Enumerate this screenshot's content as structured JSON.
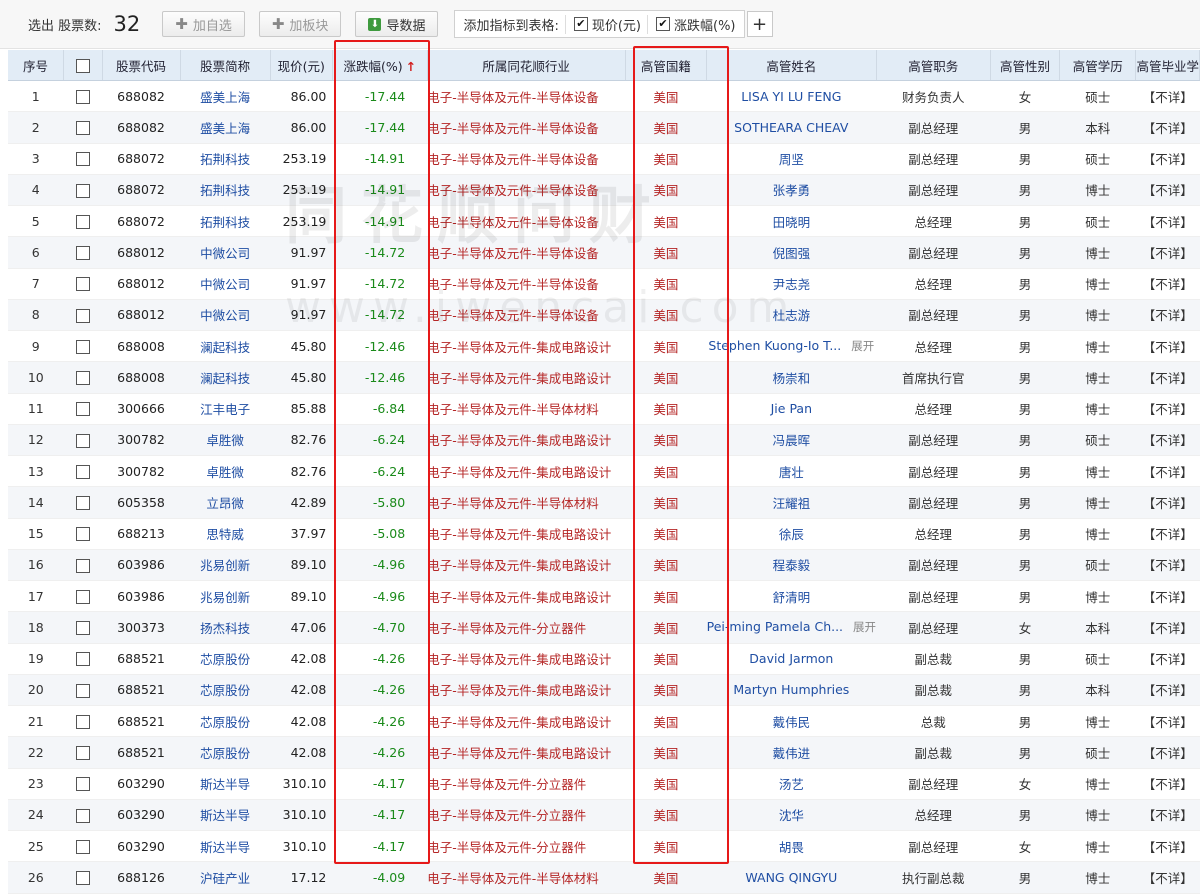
{
  "toolbar": {
    "count_label": "选出 股票数:",
    "count": "32",
    "add_watchlist": "加自选",
    "add_sector": "加板块",
    "export": "导数据",
    "add_indicator_label": "添加指标到表格:",
    "ind_price": "现价(元)",
    "ind_change": "涨跌幅(%)",
    "add_plus": "+"
  },
  "watermark": {
    "cn": "同花顺问财",
    "url": "www.iwencai.com"
  },
  "headers": {
    "seq": "序号",
    "code": "股票代码",
    "name": "股票简称",
    "price": "现价(元)",
    "change": "涨跌幅(%)",
    "industry": "所属同花顺行业",
    "nationality": "高管国籍",
    "exec_name": "高管姓名",
    "position": "高管职务",
    "gender": "高管性别",
    "education": "高管学历",
    "school": "高管毕业学"
  },
  "sort_arrow": "↑",
  "rows": [
    {
      "seq": "1",
      "code": "688082",
      "name": "盛美上海",
      "price": "86.00",
      "change": "-17.44",
      "industry": "电子-半导体及元件-半导体设备",
      "nat": "美国",
      "exec": "LISA YI LU FENG",
      "expand": "",
      "pos": "财务负责人",
      "gender": "女",
      "edu": "硕士",
      "school": "【不详】"
    },
    {
      "seq": "2",
      "code": "688082",
      "name": "盛美上海",
      "price": "86.00",
      "change": "-17.44",
      "industry": "电子-半导体及元件-半导体设备",
      "nat": "美国",
      "exec": "SOTHEARA CHEAV",
      "expand": "",
      "pos": "副总经理",
      "gender": "男",
      "edu": "本科",
      "school": "【不详】"
    },
    {
      "seq": "3",
      "code": "688072",
      "name": "拓荆科技",
      "price": "253.19",
      "change": "-14.91",
      "industry": "电子-半导体及元件-半导体设备",
      "nat": "美国",
      "exec": "周坚",
      "expand": "",
      "pos": "副总经理",
      "gender": "男",
      "edu": "硕士",
      "school": "【不详】"
    },
    {
      "seq": "4",
      "code": "688072",
      "name": "拓荆科技",
      "price": "253.19",
      "change": "-14.91",
      "industry": "电子-半导体及元件-半导体设备",
      "nat": "美国",
      "exec": "张孝勇",
      "expand": "",
      "pos": "副总经理",
      "gender": "男",
      "edu": "博士",
      "school": "【不详】"
    },
    {
      "seq": "5",
      "code": "688072",
      "name": "拓荆科技",
      "price": "253.19",
      "change": "-14.91",
      "industry": "电子-半导体及元件-半导体设备",
      "nat": "美国",
      "exec": "田晓明",
      "expand": "",
      "pos": "总经理",
      "gender": "男",
      "edu": "硕士",
      "school": "【不详】"
    },
    {
      "seq": "6",
      "code": "688012",
      "name": "中微公司",
      "price": "91.97",
      "change": "-14.72",
      "industry": "电子-半导体及元件-半导体设备",
      "nat": "美国",
      "exec": "倪图强",
      "expand": "",
      "pos": "副总经理",
      "gender": "男",
      "edu": "博士",
      "school": "【不详】"
    },
    {
      "seq": "7",
      "code": "688012",
      "name": "中微公司",
      "price": "91.97",
      "change": "-14.72",
      "industry": "电子-半导体及元件-半导体设备",
      "nat": "美国",
      "exec": "尹志尧",
      "expand": "",
      "pos": "总经理",
      "gender": "男",
      "edu": "博士",
      "school": "【不详】"
    },
    {
      "seq": "8",
      "code": "688012",
      "name": "中微公司",
      "price": "91.97",
      "change": "-14.72",
      "industry": "电子-半导体及元件-半导体设备",
      "nat": "美国",
      "exec": "杜志游",
      "expand": "",
      "pos": "副总经理",
      "gender": "男",
      "edu": "博士",
      "school": "【不详】"
    },
    {
      "seq": "9",
      "code": "688008",
      "name": "澜起科技",
      "price": "45.80",
      "change": "-12.46",
      "industry": "电子-半导体及元件-集成电路设计",
      "nat": "美国",
      "exec": "Stephen Kuong-Io T...",
      "expand": "展开",
      "pos": "总经理",
      "gender": "男",
      "edu": "博士",
      "school": "【不详】"
    },
    {
      "seq": "10",
      "code": "688008",
      "name": "澜起科技",
      "price": "45.80",
      "change": "-12.46",
      "industry": "电子-半导体及元件-集成电路设计",
      "nat": "美国",
      "exec": "杨崇和",
      "expand": "",
      "pos": "首席执行官",
      "gender": "男",
      "edu": "博士",
      "school": "【不详】"
    },
    {
      "seq": "11",
      "code": "300666",
      "name": "江丰电子",
      "price": "85.88",
      "change": "-6.84",
      "industry": "电子-半导体及元件-半导体材料",
      "nat": "美国",
      "exec": "Jie Pan",
      "expand": "",
      "pos": "总经理",
      "gender": "男",
      "edu": "博士",
      "school": "【不详】"
    },
    {
      "seq": "12",
      "code": "300782",
      "name": "卓胜微",
      "price": "82.76",
      "change": "-6.24",
      "industry": "电子-半导体及元件-集成电路设计",
      "nat": "美国",
      "exec": "冯晨晖",
      "expand": "",
      "pos": "副总经理",
      "gender": "男",
      "edu": "硕士",
      "school": "【不详】"
    },
    {
      "seq": "13",
      "code": "300782",
      "name": "卓胜微",
      "price": "82.76",
      "change": "-6.24",
      "industry": "电子-半导体及元件-集成电路设计",
      "nat": "美国",
      "exec": "唐壮",
      "expand": "",
      "pos": "副总经理",
      "gender": "男",
      "edu": "博士",
      "school": "【不详】"
    },
    {
      "seq": "14",
      "code": "605358",
      "name": "立昂微",
      "price": "42.89",
      "change": "-5.80",
      "industry": "电子-半导体及元件-半导体材料",
      "nat": "美国",
      "exec": "汪耀祖",
      "expand": "",
      "pos": "副总经理",
      "gender": "男",
      "edu": "博士",
      "school": "【不详】"
    },
    {
      "seq": "15",
      "code": "688213",
      "name": "思特威",
      "price": "37.97",
      "change": "-5.08",
      "industry": "电子-半导体及元件-集成电路设计",
      "nat": "美国",
      "exec": "徐辰",
      "expand": "",
      "pos": "总经理",
      "gender": "男",
      "edu": "博士",
      "school": "【不详】"
    },
    {
      "seq": "16",
      "code": "603986",
      "name": "兆易创新",
      "price": "89.10",
      "change": "-4.96",
      "industry": "电子-半导体及元件-集成电路设计",
      "nat": "美国",
      "exec": "程泰毅",
      "expand": "",
      "pos": "副总经理",
      "gender": "男",
      "edu": "硕士",
      "school": "【不详】"
    },
    {
      "seq": "17",
      "code": "603986",
      "name": "兆易创新",
      "price": "89.10",
      "change": "-4.96",
      "industry": "电子-半导体及元件-集成电路设计",
      "nat": "美国",
      "exec": "舒清明",
      "expand": "",
      "pos": "副总经理",
      "gender": "男",
      "edu": "博士",
      "school": "【不详】"
    },
    {
      "seq": "18",
      "code": "300373",
      "name": "扬杰科技",
      "price": "47.06",
      "change": "-4.70",
      "industry": "电子-半导体及元件-分立器件",
      "nat": "美国",
      "exec": "Pei-ming Pamela Ch...",
      "expand": "展开",
      "pos": "副总经理",
      "gender": "女",
      "edu": "本科",
      "school": "【不详】"
    },
    {
      "seq": "19",
      "code": "688521",
      "name": "芯原股份",
      "price": "42.08",
      "change": "-4.26",
      "industry": "电子-半导体及元件-集成电路设计",
      "nat": "美国",
      "exec": "David Jarmon",
      "expand": "",
      "pos": "副总裁",
      "gender": "男",
      "edu": "硕士",
      "school": "【不详】"
    },
    {
      "seq": "20",
      "code": "688521",
      "name": "芯原股份",
      "price": "42.08",
      "change": "-4.26",
      "industry": "电子-半导体及元件-集成电路设计",
      "nat": "美国",
      "exec": "Martyn Humphries",
      "expand": "",
      "pos": "副总裁",
      "gender": "男",
      "edu": "本科",
      "school": "【不详】"
    },
    {
      "seq": "21",
      "code": "688521",
      "name": "芯原股份",
      "price": "42.08",
      "change": "-4.26",
      "industry": "电子-半导体及元件-集成电路设计",
      "nat": "美国",
      "exec": "戴伟民",
      "expand": "",
      "pos": "总裁",
      "gender": "男",
      "edu": "博士",
      "school": "【不详】"
    },
    {
      "seq": "22",
      "code": "688521",
      "name": "芯原股份",
      "price": "42.08",
      "change": "-4.26",
      "industry": "电子-半导体及元件-集成电路设计",
      "nat": "美国",
      "exec": "戴伟进",
      "expand": "",
      "pos": "副总裁",
      "gender": "男",
      "edu": "硕士",
      "school": "【不详】"
    },
    {
      "seq": "23",
      "code": "603290",
      "name": "斯达半导",
      "price": "310.10",
      "change": "-4.17",
      "industry": "电子-半导体及元件-分立器件",
      "nat": "美国",
      "exec": "汤艺",
      "expand": "",
      "pos": "副总经理",
      "gender": "女",
      "edu": "博士",
      "school": "【不详】"
    },
    {
      "seq": "24",
      "code": "603290",
      "name": "斯达半导",
      "price": "310.10",
      "change": "-4.17",
      "industry": "电子-半导体及元件-分立器件",
      "nat": "美国",
      "exec": "沈华",
      "expand": "",
      "pos": "总经理",
      "gender": "男",
      "edu": "博士",
      "school": "【不详】"
    },
    {
      "seq": "25",
      "code": "603290",
      "name": "斯达半导",
      "price": "310.10",
      "change": "-4.17",
      "industry": "电子-半导体及元件-分立器件",
      "nat": "美国",
      "exec": "胡畏",
      "expand": "",
      "pos": "副总经理",
      "gender": "女",
      "edu": "博士",
      "school": "【不详】"
    },
    {
      "seq": "26",
      "code": "688126",
      "name": "沪硅产业",
      "price": "17.12",
      "change": "-4.09",
      "industry": "电子-半导体及元件-半导体材料",
      "nat": "美国",
      "exec": "WANG QINGYU",
      "expand": "",
      "pos": "执行副总裁",
      "gender": "男",
      "edu": "博士",
      "school": "【不详】"
    }
  ]
}
